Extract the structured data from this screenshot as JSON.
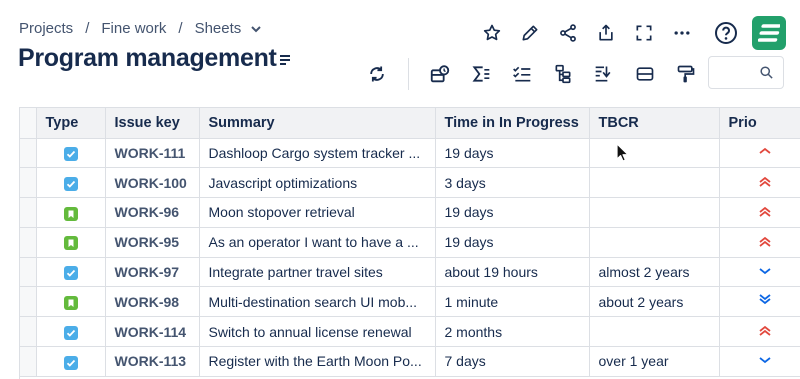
{
  "breadcrumb": {
    "items": [
      "Projects",
      "Fine work",
      "Sheets"
    ],
    "separator": "/"
  },
  "page": {
    "title": "Program management"
  },
  "top_actions": [
    "star-icon",
    "edit-icon",
    "share-icon",
    "export-icon",
    "fullscreen-icon",
    "more-icon",
    "help-icon"
  ],
  "toolbar": [
    "refresh-icon",
    "layout-icon",
    "sum-icon",
    "checklist-icon",
    "hierarchy-icon",
    "filter-list-icon",
    "group-icon",
    "format-paint-icon"
  ],
  "search": {
    "value": "",
    "placeholder": ""
  },
  "colors": {
    "accent_green": "#22a06b",
    "task_blue": "#4bade8",
    "story_green": "#63ba3c",
    "prio_high": "#e2483d",
    "prio_low": "#0c66e4"
  },
  "table": {
    "columns": [
      "Type",
      "Issue key",
      "Summary",
      "Time in In Progress",
      "TBCR",
      "Prio"
    ],
    "rows": [
      {
        "type": "task",
        "key": "WORK-111",
        "summary": "Dashloop Cargo system tracker ...",
        "time": "19 days",
        "tbcr": "",
        "prio": "high"
      },
      {
        "type": "task",
        "key": "WORK-100",
        "summary": "Javascript optimizations",
        "time": "3 days",
        "tbcr": "",
        "prio": "highest"
      },
      {
        "type": "story",
        "key": "WORK-96",
        "summary": "Moon stopover retrieval",
        "time": "19 days",
        "tbcr": "",
        "prio": "highest"
      },
      {
        "type": "story",
        "key": "WORK-95",
        "summary": "As an operator I want to have a ...",
        "time": "19 days",
        "tbcr": "",
        "prio": "highest"
      },
      {
        "type": "task",
        "key": "WORK-97",
        "summary": "Integrate partner travel sites",
        "time": "about 19 hours",
        "tbcr": "almost 2 years",
        "prio": "low"
      },
      {
        "type": "story",
        "key": "WORK-98",
        "summary": "Multi-destination search UI mob...",
        "time": "1 minute",
        "tbcr": "about 2 years",
        "prio": "lowest"
      },
      {
        "type": "task",
        "key": "WORK-114",
        "summary": "Switch to annual license renewal",
        "time": "2 months",
        "tbcr": "",
        "prio": "highest"
      },
      {
        "type": "task",
        "key": "WORK-113",
        "summary": "Register with the Earth Moon Po...",
        "time": "7 days",
        "tbcr": "over 1 year",
        "prio": "low"
      }
    ]
  }
}
